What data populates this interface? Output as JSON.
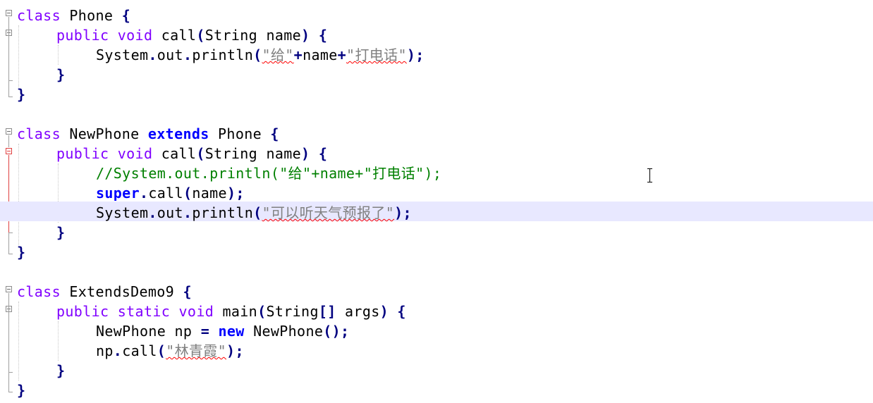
{
  "lines": [
    {
      "id": "l1",
      "parts": [
        "class",
        " Phone ",
        "{"
      ]
    },
    {
      "id": "l2",
      "parts": [
        "public",
        " ",
        "void",
        " call",
        "(",
        "String name",
        ")",
        " ",
        "{"
      ]
    },
    {
      "id": "l3",
      "parts": [
        "System",
        ".",
        "out",
        ".",
        "println",
        "(",
        "\"给\"",
        "+",
        "name",
        "+",
        "\"打电话\"",
        ")",
        ";"
      ]
    },
    {
      "id": "l4",
      "parts": [
        "}"
      ]
    },
    {
      "id": "l5",
      "parts": [
        "}"
      ]
    },
    {
      "id": "l6",
      "parts": [
        "class",
        " NewPhone ",
        "extends",
        " Phone ",
        "{"
      ]
    },
    {
      "id": "l7",
      "parts": [
        "public",
        " ",
        "void",
        " call",
        "(",
        "String name",
        ")",
        " ",
        "{"
      ]
    },
    {
      "id": "l8",
      "parts": [
        "//System.out.println(\"给\"+name+\"打电话\");"
      ]
    },
    {
      "id": "l9",
      "parts": [
        "super",
        ".",
        "call",
        "(",
        "name",
        ")",
        ";"
      ]
    },
    {
      "id": "l10",
      "parts": [
        "System",
        ".",
        "out",
        ".",
        "println",
        "(",
        "\"可以听天气预报了\"",
        ")",
        ";"
      ]
    },
    {
      "id": "l11",
      "parts": [
        "}"
      ]
    },
    {
      "id": "l12",
      "parts": [
        "}"
      ]
    },
    {
      "id": "l13",
      "parts": [
        "class",
        " ExtendsDemo9 ",
        "{"
      ]
    },
    {
      "id": "l14",
      "parts": [
        "public",
        " ",
        "static",
        " ",
        "void",
        " main",
        "(",
        "String",
        "[]",
        " args",
        ")",
        " ",
        "{"
      ]
    },
    {
      "id": "l15",
      "parts": [
        "NewPhone np ",
        "=",
        " ",
        "new",
        " NewPhone",
        "()",
        ";"
      ]
    },
    {
      "id": "l16",
      "parts": [
        "np",
        ".",
        "call",
        "(",
        "\"林青霞\"",
        ")",
        ";"
      ]
    },
    {
      "id": "l17",
      "parts": [
        "}"
      ]
    },
    {
      "id": "l18",
      "parts": [
        "}"
      ]
    }
  ],
  "theme": {
    "keyword": "#8000ff",
    "keyword_bold": "#0000ff",
    "operator": "#000080",
    "string": "#808080",
    "comment": "#008000",
    "current_line": "#e8e8ff",
    "fold_active": "#e04040"
  },
  "icons": {
    "fold_marker": "minus-box-icon",
    "mouse_cursor": "text-ibeam-cursor-icon"
  }
}
